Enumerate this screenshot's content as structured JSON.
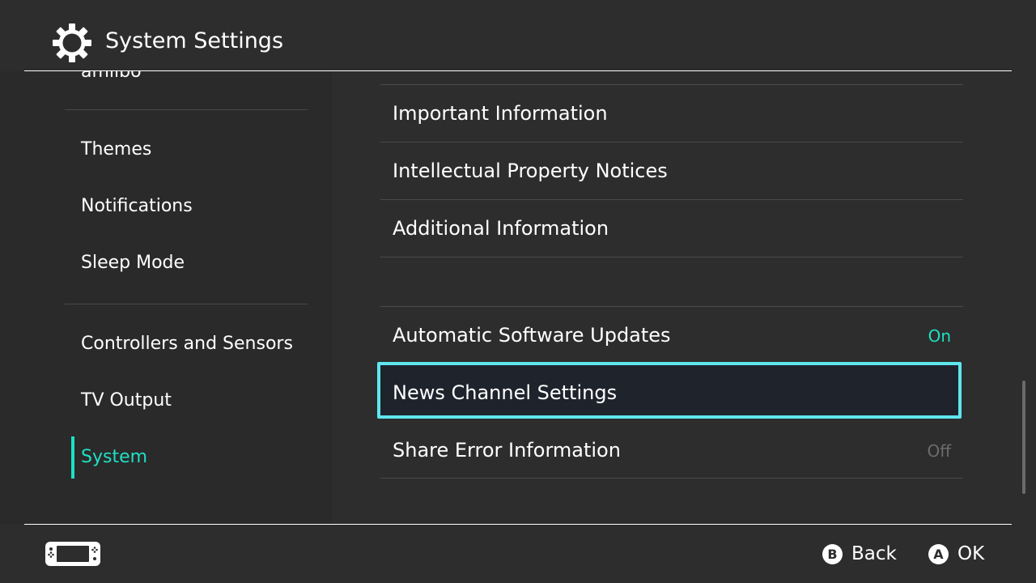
{
  "header": {
    "title": "System Settings",
    "icon": "gear-icon"
  },
  "sidebar": {
    "items": [
      {
        "label": "amiibo"
      },
      {
        "label": "Themes"
      },
      {
        "label": "Notifications"
      },
      {
        "label": "Sleep Mode"
      },
      {
        "label": "Controllers and Sensors"
      },
      {
        "label": "TV Output"
      },
      {
        "label": "System",
        "selected": true
      }
    ]
  },
  "main": {
    "rows": [
      {
        "label": "Important Information"
      },
      {
        "label": "Intellectual Property Notices"
      },
      {
        "label": "Additional Information"
      },
      {
        "label": "Automatic Software Updates",
        "value": "On"
      },
      {
        "label": "News Channel Settings",
        "focused": true
      },
      {
        "label": "Share Error Information",
        "value": "Off"
      }
    ]
  },
  "footer": {
    "console_icon": "console-icon",
    "back": {
      "glyph": "B",
      "label": "Back"
    },
    "ok": {
      "glyph": "A",
      "label": "OK"
    }
  },
  "colors": {
    "background": "#2d2d2d",
    "sidebar_background": "#2a2a2a",
    "accent": "#1fe0c4",
    "focus_border": "#5ee6ee",
    "focus_fill": "#1f232c",
    "separator": "#4a4a4a",
    "value_off": "#6c6c6c"
  }
}
